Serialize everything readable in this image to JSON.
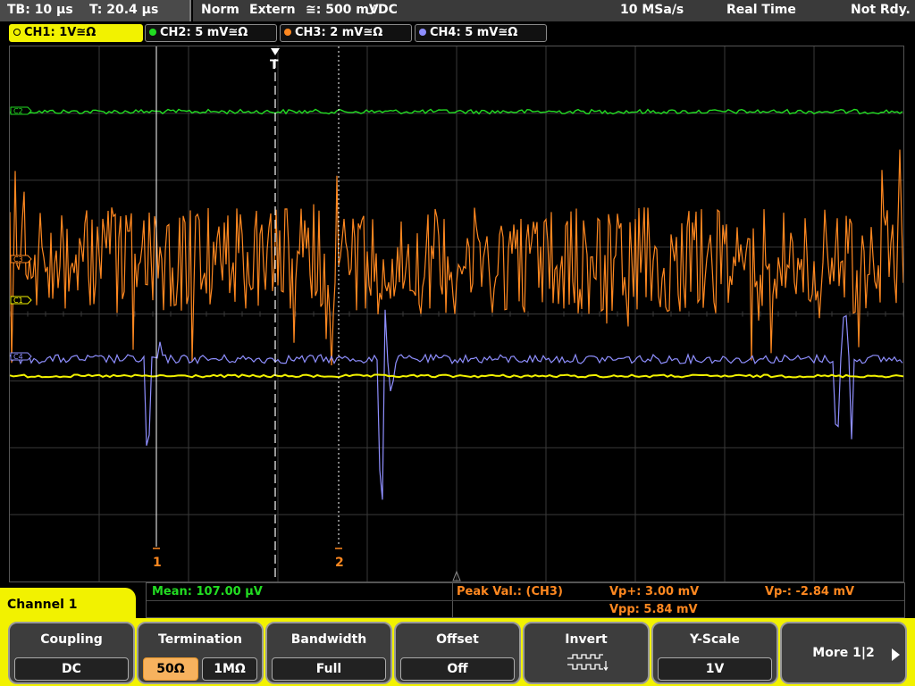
{
  "topbar": {
    "timebase": "TB: 10 µs",
    "trigger_time": "T: 20.4 µs",
    "mode": "Norm",
    "trigger_source": "Extern",
    "trigger_level": "≅: 500 mV",
    "trigger_edge": "DC",
    "sample_rate": "10 MSa/s",
    "acq_mode": "Real Time",
    "status": "Not Rdy."
  },
  "channels": [
    {
      "label": "CH1: 1V≅Ω",
      "color": "#f2f200"
    },
    {
      "label": "CH2: 5 mV≅Ω",
      "color": "#22dd22"
    },
    {
      "label": "CH3: 2 mV≅Ω",
      "color": "#ff8820"
    },
    {
      "label": "CH4: 5 mV≅Ω",
      "color": "#8f8fff"
    }
  ],
  "screen": {
    "cursor1_label": "1",
    "cursor2_label": "2",
    "marker_ch1": "C1",
    "marker_ch2": "C2",
    "marker_ch3": "C3",
    "marker_ch4": "C4"
  },
  "measurement": {
    "mean": "Mean: 107.00 µV",
    "peak_label": "Peak Val.: (CH3)",
    "vp_plus": "Vp+: 3.00 mV",
    "vpp": "Vpp: 5.84 mV",
    "vp_minus": "Vp-: -2.84 mV"
  },
  "channel_menu_title": "Channel 1",
  "softkeys": {
    "coupling": {
      "title": "Coupling",
      "value": "DC"
    },
    "termination": {
      "title": "Termination",
      "opt1": "50Ω",
      "opt2": "1MΩ"
    },
    "bandwidth": {
      "title": "Bandwidth",
      "value": "Full"
    },
    "offset": {
      "title": "Offset",
      "value": "Off"
    },
    "invert": {
      "title": "Invert"
    },
    "yscale": {
      "title": "Y-Scale",
      "value": "1V"
    },
    "more": {
      "label": "More 1|2"
    }
  },
  "colors": {
    "accent": "#f2f200",
    "ch1": "#f2f200",
    "ch2": "#22dd22",
    "ch3": "#ff8820",
    "ch4": "#8f8fff",
    "grid": "#3a3a3a"
  }
}
